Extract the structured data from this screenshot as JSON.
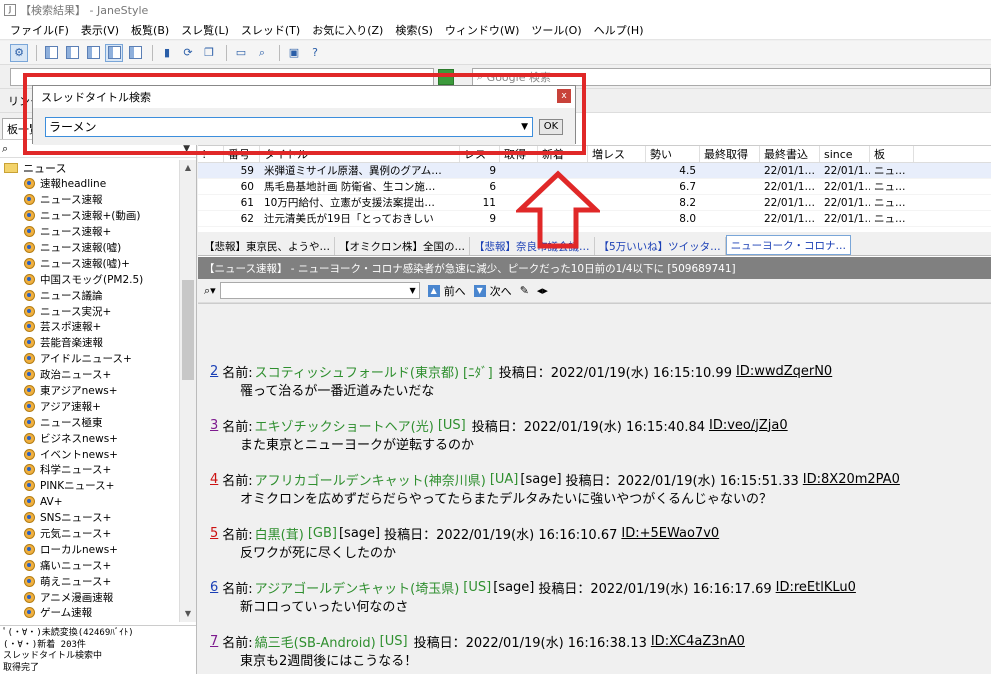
{
  "window": {
    "title": "【検索結果】 - JaneStyle"
  },
  "menu": [
    "ファイル(F)",
    "表示(V)",
    "板覧(B)",
    "スレ覧(L)",
    "スレッド(T)",
    "お気に入り(Z)",
    "検索(S)",
    "ウィンドウ(W)",
    "ツール(O)",
    "ヘルプ(H)"
  ],
  "search_engine": {
    "placeholder": "Google 検索"
  },
  "link_bar": {
    "label": "リンク"
  },
  "left_tab": {
    "label": "板一覧"
  },
  "tree": {
    "folder": "ニュース",
    "items": [
      "速報headline",
      "ニュース速報",
      "ニュース速報+(動画)",
      "ニュース速報+",
      "ニュース速報(嘘)",
      "ニュース速報(嘘)+",
      "中国スモッグ(PM2.5)",
      "ニュース議論",
      "ニュース実況+",
      "芸スポ速報+",
      "芸能音楽速報",
      "アイドルニュース+",
      "政治ニュース+",
      "東アジアnews+",
      "アジア速報+",
      "ニュース極東",
      "ビジネスnews+",
      "イベントnews+",
      "科学ニュース+",
      "PINKニュース+",
      "AV+",
      "SNSニュース+",
      "元気ニュース+",
      "ローカルnews+",
      "痛いニュース+",
      "萌えニュース+",
      "アニメ漫画速報",
      "ゲーム速報"
    ]
  },
  "status": {
    "lines": [
      "ﾟ(・∀・)未読変換(42469ﾊﾞｲﾄ)",
      "(・∀・)新着 203件",
      "スレッドタイトル検索中",
      "取得完了"
    ]
  },
  "thread_list": {
    "headers": [
      "!",
      "番号",
      "タイトル",
      "レス",
      "取得",
      "新着",
      "増レス",
      "勢い",
      "最終取得",
      "最終書込",
      "since",
      "板"
    ],
    "rows": [
      {
        "no": "59",
        "title": "米弾道ミサイル原潜、異例のグアム…",
        "res": "9",
        "seiki": "4.5",
        "lastw": "22/01/1…",
        "since": "22/01/1…",
        "board": "ニュ…"
      },
      {
        "no": "60",
        "title": "馬毛島基地計画 防衛省、生コン施…",
        "res": "6",
        "seiki": "6.7",
        "lastw": "22/01/1…",
        "since": "22/01/1…",
        "board": "ニュ…"
      },
      {
        "no": "61",
        "title": "10万円給付、立憲が支援法案提出…",
        "res": "11",
        "seiki": "8.2",
        "lastw": "22/01/1…",
        "since": "22/01/1…",
        "board": "ニュ…"
      },
      {
        "no": "62",
        "title": "辻元清美氏が19日「とっておきしい",
        "res": "9",
        "seiki": "8.0",
        "lastw": "22/01/1…",
        "since": "22/01/1…",
        "board": "ニュ…"
      }
    ]
  },
  "thread_tabs": [
    {
      "label": "【悲報】東京民、ようや…",
      "style": "plain"
    },
    {
      "label": "【オミクロン株】全国の…",
      "style": "plain"
    },
    {
      "label": "【悲報】奈良市議会議…",
      "style": "blue"
    },
    {
      "label": "【5万いいね】ツイッタ…",
      "style": "blue"
    },
    {
      "label": "ニューヨーク・コロナ…",
      "style": "active"
    }
  ],
  "thread_header": "【ニュース速報】 - ニューヨーク・コロナ感染者が急速に減少、ピークだった10日前の1/4以下に [509689741]",
  "find_bar": {
    "prev": "前へ",
    "next": "次へ"
  },
  "posts": [
    {
      "num": "2",
      "color": "blue",
      "name": "スコティッシュフォールド(東京都)",
      "trip": "[ﾆﾀﾞ]",
      "mail": "",
      "date": "投稿日：2022/01/19(水) 16:15:10.99",
      "id": "ID:wwdZqerN0",
      "body": "罹って治るが一番近道みたいだな"
    },
    {
      "num": "3",
      "color": "purple",
      "name": "エキゾチックショートヘア(光)",
      "trip": "[US]",
      "mail": "",
      "date": "投稿日：2022/01/19(水) 16:15:40.84",
      "id": "ID:veo/jZja0",
      "body": "また東京とニューヨークが逆転するのか"
    },
    {
      "num": "4",
      "color": "red",
      "name": "アフリカゴールデンキャット(神奈川県)",
      "trip": "[UA]",
      "mail": "[sage]",
      "date": "投稿日：2022/01/19(水) 16:15:51.33",
      "id": "ID:8X20m2PA0",
      "body": "オミクロンを広めずだらだらやってたらまたデルタみたいに強いやつがくるんじゃないの？"
    },
    {
      "num": "5",
      "color": "red",
      "name": "白黒(茸)",
      "trip": "[GB]",
      "mail": "[sage]",
      "date": "投稿日：2022/01/19(水) 16:16:10.67",
      "id": "ID:+5EWao7v0",
      "body": "反ワクが死に尽くしたのか"
    },
    {
      "num": "6",
      "color": "blue",
      "name": "アジアゴールデンキャット(埼玉県)",
      "trip": "[US]",
      "mail": "[sage]",
      "date": "投稿日：2022/01/19(水) 16:16:17.69",
      "id": "ID:reEtlKLu0",
      "body": "新コロっていったい何なのさ"
    },
    {
      "num": "7",
      "color": "purple",
      "name": "縞三毛(SB-Android)",
      "trip": "[US]",
      "mail": "",
      "date": "投稿日：2022/01/19(水) 16:16:38.13",
      "id": "ID:XC4aZ3nA0",
      "body": "東京も2週間後にはこうなる！"
    }
  ],
  "dialog": {
    "title": "スレッドタイトル検索",
    "value": "ラーメン",
    "ok": "OK",
    "close": "x"
  },
  "colors": {
    "highlight": "#e02828",
    "name_green": "#2f8f2f",
    "link_blue": "#1a3fb5"
  }
}
